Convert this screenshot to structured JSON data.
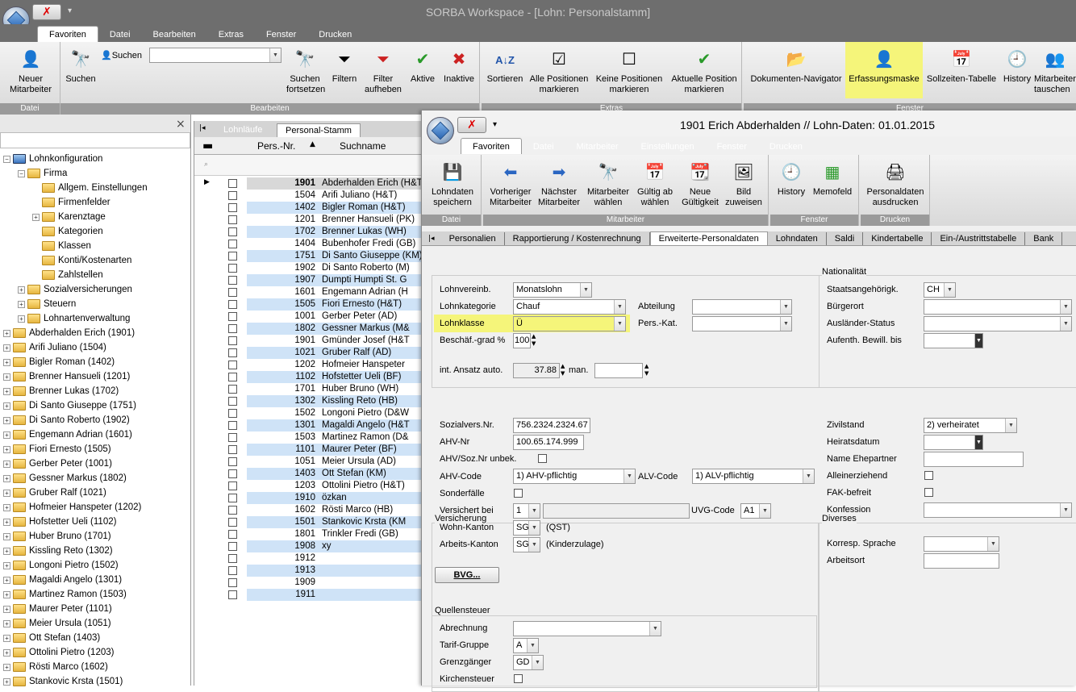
{
  "app": {
    "title": "SORBA Workspace - [Lohn: Personalstamm]",
    "quick_access": "▾"
  },
  "main_tabs": [
    "Favoriten",
    "Datei",
    "Bearbeiten",
    "Extras",
    "Fenster",
    "Drucken"
  ],
  "main_ribbon": {
    "groups": [
      "Datei",
      "Bearbeiten",
      "Extras",
      "Fenster"
    ],
    "buttons": {
      "neuer_mitarbeiter": "Neuer\nMitarbeiter",
      "suchen": "Suchen",
      "suchen_label": "Suchen",
      "suchen_fortsetzen": "Suchen\nfortsetzen",
      "filtern": "Filtern",
      "filter_aufheben": "Filter\naufheben",
      "aktive": "Aktive",
      "inaktive": "Inaktive",
      "sortieren": "Sortieren",
      "alle_markieren": "Alle Positionen\nmarkieren",
      "keine_markieren": "Keine Positionen\nmarkieren",
      "aktuelle_markieren": "Aktuelle Position\nmarkieren",
      "dokumenten_navigator": "Dokumenten-Navigator",
      "erfassungsmaske": "Erfassungsmaske",
      "sollzeiten": "Sollzeiten-Tabelle",
      "history": "History",
      "mitarbeiter_tauschen": "Mitarbeiter\ntauschen"
    }
  },
  "tree": {
    "close": "×",
    "items": [
      {
        "label": "Lohnkonfiguration",
        "level": 0,
        "exp": "−"
      },
      {
        "label": "Firma",
        "level": 1,
        "exp": "−"
      },
      {
        "label": "Allgem. Einstellungen",
        "level": 2,
        "exp": ""
      },
      {
        "label": "Firmenfelder",
        "level": 2,
        "exp": ""
      },
      {
        "label": "Karenztage",
        "level": 2,
        "exp": "+"
      },
      {
        "label": "Kategorien",
        "level": 2,
        "exp": ""
      },
      {
        "label": "Klassen",
        "level": 2,
        "exp": ""
      },
      {
        "label": "Konti/Kostenarten",
        "level": 2,
        "exp": ""
      },
      {
        "label": "Zahlstellen",
        "level": 2,
        "exp": ""
      },
      {
        "label": "Sozialversicherungen",
        "level": 1,
        "exp": "+"
      },
      {
        "label": "Steuern",
        "level": 1,
        "exp": "+"
      },
      {
        "label": "Lohnartenverwaltung",
        "level": 1,
        "exp": "+"
      },
      {
        "label": "Abderhalden Erich (1901)",
        "level": 0,
        "exp": "+"
      },
      {
        "label": "Arifi Juliano (1504)",
        "level": 0,
        "exp": "+"
      },
      {
        "label": "Bigler Roman (1402)",
        "level": 0,
        "exp": "+"
      },
      {
        "label": "Brenner Hansueli (1201)",
        "level": 0,
        "exp": "+"
      },
      {
        "label": "Brenner Lukas (1702)",
        "level": 0,
        "exp": "+"
      },
      {
        "label": "Di Santo Giuseppe (1751)",
        "level": 0,
        "exp": "+"
      },
      {
        "label": "Di Santo Roberto (1902)",
        "level": 0,
        "exp": "+"
      },
      {
        "label": "Engemann Adrian (1601)",
        "level": 0,
        "exp": "+"
      },
      {
        "label": "Fiori Ernesto (1505)",
        "level": 0,
        "exp": "+"
      },
      {
        "label": "Gerber Peter (1001)",
        "level": 0,
        "exp": "+"
      },
      {
        "label": "Gessner Markus (1802)",
        "level": 0,
        "exp": "+"
      },
      {
        "label": "Gruber Ralf (1021)",
        "level": 0,
        "exp": "+"
      },
      {
        "label": "Hofmeier Hanspeter (1202)",
        "level": 0,
        "exp": "+"
      },
      {
        "label": "Hofstetter Ueli (1102)",
        "level": 0,
        "exp": "+"
      },
      {
        "label": "Huber Bruno (1701)",
        "level": 0,
        "exp": "+"
      },
      {
        "label": "Kissling Reto (1302)",
        "level": 0,
        "exp": "+"
      },
      {
        "label": "Longoni Pietro (1502)",
        "level": 0,
        "exp": "+"
      },
      {
        "label": "Magaldi Angelo (1301)",
        "level": 0,
        "exp": "+"
      },
      {
        "label": "Martinez Ramon (1503)",
        "level": 0,
        "exp": "+"
      },
      {
        "label": "Maurer Peter (1101)",
        "level": 0,
        "exp": "+"
      },
      {
        "label": "Meier Ursula (1051)",
        "level": 0,
        "exp": "+"
      },
      {
        "label": "Ott Stefan (1403)",
        "level": 0,
        "exp": "+"
      },
      {
        "label": "Ottolini Pietro (1203)",
        "level": 0,
        "exp": "+"
      },
      {
        "label": "Rösti Marco (1602)",
        "level": 0,
        "exp": "+"
      },
      {
        "label": "Stankovic Krsta (1501)",
        "level": 0,
        "exp": "+"
      }
    ]
  },
  "grid": {
    "tabs": [
      "Lohnläufe",
      "Personal-Stamm"
    ],
    "columns": [
      "Pers.-Nr.",
      "Suchname"
    ],
    "rows": [
      {
        "nr": "1901",
        "name": "Abderhalden Erich (H&T)"
      },
      {
        "nr": "1504",
        "name": "Arifi Juliano (H&T)"
      },
      {
        "nr": "1402",
        "name": "Bigler Roman (H&T)"
      },
      {
        "nr": "1201",
        "name": "Brenner Hansueli (PK)"
      },
      {
        "nr": "1702",
        "name": "Brenner Lukas (WH)"
      },
      {
        "nr": "1404",
        "name": "Bubenhofer Fredi (GB)"
      },
      {
        "nr": "1751",
        "name": "Di Santo Giuseppe (KM)"
      },
      {
        "nr": "1902",
        "name": "Di Santo Roberto (M)"
      },
      {
        "nr": "1907",
        "name": "Dumpti Humpti St. G"
      },
      {
        "nr": "1601",
        "name": "Engemann Adrian (H"
      },
      {
        "nr": "1505",
        "name": "Fiori Ernesto (H&T)"
      },
      {
        "nr": "1001",
        "name": "Gerber Peter (AD)"
      },
      {
        "nr": "1802",
        "name": "Gessner Markus (M&"
      },
      {
        "nr": "1901",
        "name": "Gmünder Josef (H&T"
      },
      {
        "nr": "1021",
        "name": "Gruber Ralf (AD)"
      },
      {
        "nr": "1202",
        "name": "Hofmeier Hanspeter"
      },
      {
        "nr": "1102",
        "name": "Hofstetter Ueli (BF)"
      },
      {
        "nr": "1701",
        "name": "Huber Bruno (WH)"
      },
      {
        "nr": "1302",
        "name": "Kissling Reto (HB)"
      },
      {
        "nr": "1502",
        "name": "Longoni Pietro (D&W"
      },
      {
        "nr": "1301",
        "name": "Magaldi Angelo (H&T"
      },
      {
        "nr": "1503",
        "name": "Martinez Ramon (D&"
      },
      {
        "nr": "1101",
        "name": "Maurer Peter (BF)"
      },
      {
        "nr": "1051",
        "name": "Meier Ursula (AD)"
      },
      {
        "nr": "1403",
        "name": "Ott Stefan (KM)"
      },
      {
        "nr": "1203",
        "name": "Ottolini Pietro (H&T)"
      },
      {
        "nr": "1910",
        "name": "özkan"
      },
      {
        "nr": "1602",
        "name": "Rösti Marco (HB)"
      },
      {
        "nr": "1501",
        "name": "Stankovic Krsta (KM"
      },
      {
        "nr": "1801",
        "name": "Trinkler Fredi (GB)"
      },
      {
        "nr": "1908",
        "name": "xy"
      },
      {
        "nr": "1912",
        "name": ""
      },
      {
        "nr": "1913",
        "name": ""
      },
      {
        "nr": "1909",
        "name": ""
      },
      {
        "nr": "1911",
        "name": ""
      }
    ]
  },
  "child": {
    "title": "1901 Erich Abderhalden // Lohn-Daten: 01.01.2015",
    "tabs": [
      "Favoriten",
      "Datei",
      "Mitarbeiter",
      "Einstellungen",
      "Fenster",
      "Drucken"
    ],
    "groups": [
      "Datei",
      "Mitarbeiter",
      "Fenster",
      "Drucken"
    ],
    "buttons": {
      "speichern": "Lohndaten\nspeichern",
      "vorheriger": "Vorheriger\nMitarbeiter",
      "naechster": "Nächster\nMitarbeiter",
      "ma_waehlen": "Mitarbeiter\nwählen",
      "gueltig_ab": "Gültig ab\nwählen",
      "neue_gueltigkeit": "Neue\nGültigkeit",
      "bild": "Bild\nzuweisen",
      "history": "History",
      "memofeld": "Memofeld",
      "ausdrucken": "Personaldaten\nausdrucken"
    },
    "subtabs": [
      "Personalien",
      "Rapportierung / Kostenrechnung",
      "Erweiterte-Personaldaten",
      "Lohndaten",
      "Saldi",
      "Kindertabelle",
      "Ein-/Austrittstabelle",
      "Bank"
    ],
    "form": {
      "lohnvereinb_lbl": "Lohnvereinb.",
      "lohnvereinb": "Monatslohn",
      "lohnkategorie_lbl": "Lohnkategorie",
      "lohnkategorie": "Chauf",
      "abteilung_lbl": "Abteilung",
      "lohnklasse_lbl": "Lohnklasse",
      "lohnklasse": "Ü",
      "perskat_lbl": "Pers.-Kat.",
      "beschgrad_lbl": "Beschäf.-grad %",
      "beschgrad": "100",
      "ansatz_lbl": "int. Ansatz auto.",
      "ansatz": "37.88",
      "man_lbl": "man.",
      "nationalitaet": "Nationalität",
      "staat_lbl": "Staatsangehörigk.",
      "staat": "CH",
      "buergerort_lbl": "Bürgerort",
      "auslaender_lbl": "Ausländer-Status",
      "aufenth_lbl": "Aufenth. Bewill. bis",
      "versicherung": "Versicherung",
      "sozvers_lbl": "Sozialvers.Nr.",
      "sozvers": "756.2324.2324.67",
      "ahvnr_lbl": "AHV-Nr",
      "ahvnr": "100.65.174.999",
      "ahvunbek_lbl": "AHV/Soz.Nr unbek.",
      "ahvcode_lbl": "AHV-Code",
      "ahvcode": "1) AHV-pflichtig",
      "alvcode_lbl": "ALV-Code",
      "alvcode": "1) ALV-pflichtig",
      "sonder_lbl": "Sonderfälle",
      "versbei_lbl": "Versichert bei",
      "versbei": "1",
      "uvg_lbl": "UVG-Code",
      "uvg": "A1",
      "wohnk_lbl": "Wohn-Kanton",
      "wohnk": "SG",
      "wohnk_note": "(QST)",
      "arbk_lbl": "Arbeits-Kanton",
      "arbk": "SG",
      "arbk_note": "(Kinderzulage)",
      "bvg_btn": "BVG...",
      "diverses": "Diverses",
      "zivil_lbl": "Zivilstand",
      "zivil": "2) verheiratet",
      "heirat_lbl": "Heiratsdatum",
      "ehepartner_lbl": "Name Ehepartner",
      "allein_lbl": "Alleinerziehend",
      "fak_lbl": "FAK-befreit",
      "konfession_lbl": "Konfession",
      "sprache_lbl": "Korresp. Sprache",
      "arbeitsort_lbl": "Arbeitsort",
      "quellensteuer": "Quellensteuer",
      "abrechnung_lbl": "Abrechnung",
      "tarif_lbl": "Tarif-Gruppe",
      "tarif": "A",
      "grenz_lbl": "Grenzgänger",
      "grenz": "GD",
      "kirche_lbl": "Kirchensteuer"
    }
  }
}
